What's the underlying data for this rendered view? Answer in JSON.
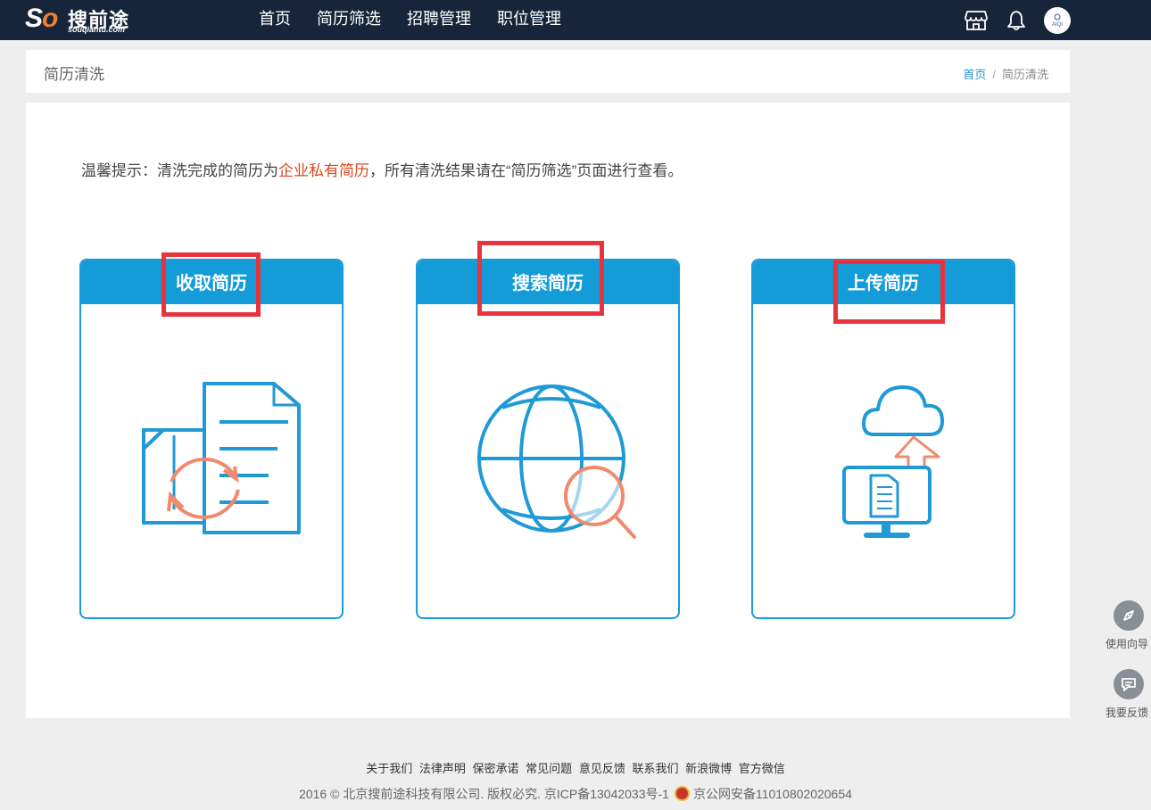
{
  "brand": {
    "logo_mark": "So",
    "name_cn": "搜前途",
    "name_en": "souqiantu.com"
  },
  "nav": {
    "items": [
      "首页",
      "简历筛选",
      "招聘管理",
      "职位管理"
    ]
  },
  "header_icons": [
    "store-icon",
    "bell-icon"
  ],
  "avatar": {
    "text": "AIQI"
  },
  "page": {
    "title": "简历清洗"
  },
  "breadcrumb": {
    "home": "首页",
    "separator": "/",
    "current": "简历清洗"
  },
  "tip": {
    "prefix": "温馨提示：清洗完成的简历为",
    "highlight": "企业私有简历",
    "suffix": "，所有清洗结果请在“简历筛选”页面进行查看。"
  },
  "cards": [
    {
      "title": "收取简历",
      "icon": "documents-sync-icon"
    },
    {
      "title": "搜索简历",
      "icon": "globe-search-icon"
    },
    {
      "title": "上传简历",
      "icon": "cloud-upload-icon"
    }
  ],
  "side": {
    "guide": "使用向导",
    "feedback": "我要反馈"
  },
  "footer": {
    "links": [
      "关于我们",
      "法律声明",
      "保密承诺",
      "常见问题",
      "意见反馈",
      "联系我们",
      "新浪微博",
      "官方微信"
    ],
    "copyright": "2016 © 北京搜前途科技有限公司. 版权必究. 京ICP备13042033号-1",
    "police": "京公网安备11010802020654"
  },
  "colors": {
    "nav_bg": "#16253a",
    "accent": "#149cd9",
    "highlight_text": "#d9461e",
    "annotation_box": "#e8323c",
    "icon_orange": "#f08a6e"
  }
}
